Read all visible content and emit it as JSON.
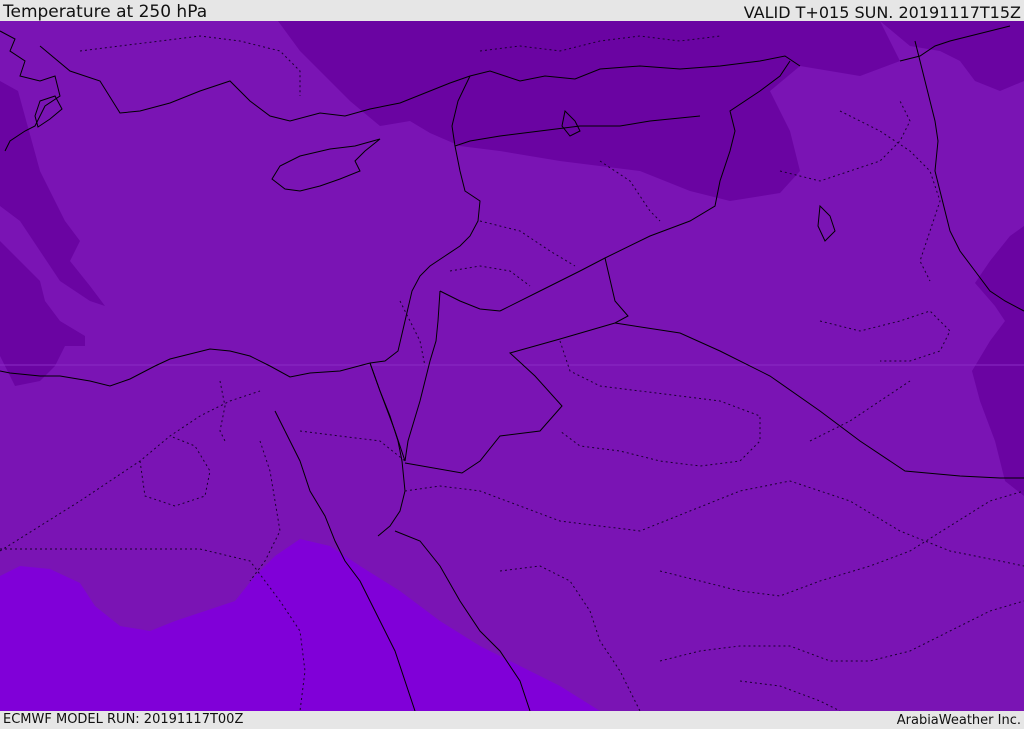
{
  "header": {
    "title": "Temperature at 250 hPa",
    "valid_time": "VALID T+015 SUN. 20191117T15Z"
  },
  "footer": {
    "model_run": "ECMWF MODEL RUN: 20191117T00Z",
    "credit": "ArabiaWeather Inc."
  },
  "map": {
    "variable": "temperature",
    "pressure_level_hpa": 250,
    "colors": {
      "main_band": "#7a14b4",
      "cold_band": "#6a04a2",
      "warm_band": "#8000d8",
      "coastline": "#000000",
      "border": "#000000"
    }
  }
}
